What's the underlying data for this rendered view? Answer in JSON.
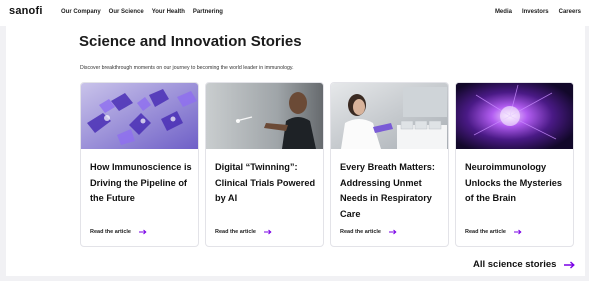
{
  "header": {
    "logo": "sanofi",
    "nav_left": [
      "Our Company",
      "Our Science",
      "Your Health",
      "Partnering"
    ],
    "nav_right": [
      "Media",
      "Investors",
      "Careers"
    ]
  },
  "section": {
    "title": "Science and Innovation Stories",
    "subtitle": "Discover breakthrough moments on our journey to becoming the world leader in immunology."
  },
  "cards": [
    {
      "title": "How Immunoscience is Driving the Pipeline of the Future",
      "link": "Read the article",
      "image": "purple-immune-cells-image"
    },
    {
      "title": "Digital “Twinning”: Clinical Trials Powered by AI",
      "link": "Read the article",
      "image": "scientist-touching-screen-image"
    },
    {
      "title": "Every Breath Matters: Addressing Unmet Needs in Respiratory Care",
      "link": "Read the article",
      "image": "lab-researcher-pipette-image"
    },
    {
      "title": "Neuroimmunology Unlocks the Mysteries of the Brain",
      "link": "Read the article",
      "image": "glowing-neuron-image"
    }
  ],
  "footer_link": "All science stories",
  "colors": {
    "accent": "#7a00e6",
    "background": "#f1f1f4",
    "panel": "#ffffff",
    "text": "#111111"
  }
}
